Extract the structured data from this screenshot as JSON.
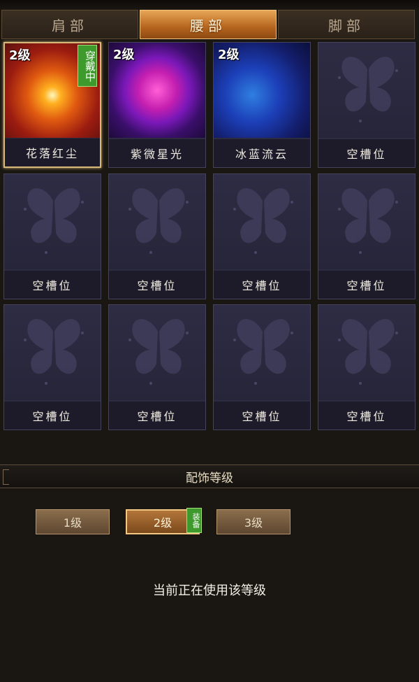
{
  "tabs": [
    {
      "label": "肩部",
      "active": false
    },
    {
      "label": "腰部",
      "active": true
    },
    {
      "label": "脚部",
      "active": false
    }
  ],
  "slots": [
    {
      "name": "花落红尘",
      "level": "2级",
      "badge": "穿戴中",
      "art": "flame"
    },
    {
      "name": "紫微星光",
      "level": "2级",
      "badge": "",
      "art": "purple"
    },
    {
      "name": "冰蓝流云",
      "level": "2级",
      "badge": "",
      "art": "blue"
    },
    {
      "name": "空槽位",
      "level": "",
      "badge": "",
      "art": "empty"
    },
    {
      "name": "空槽位",
      "level": "",
      "badge": "",
      "art": "empty"
    },
    {
      "name": "空槽位",
      "level": "",
      "badge": "",
      "art": "empty"
    },
    {
      "name": "空槽位",
      "level": "",
      "badge": "",
      "art": "empty"
    },
    {
      "name": "空槽位",
      "level": "",
      "badge": "",
      "art": "empty"
    },
    {
      "name": "空槽位",
      "level": "",
      "badge": "",
      "art": "empty"
    },
    {
      "name": "空槽位",
      "level": "",
      "badge": "",
      "art": "empty"
    },
    {
      "name": "空槽位",
      "level": "",
      "badge": "",
      "art": "empty"
    },
    {
      "name": "空槽位",
      "level": "",
      "badge": "",
      "art": "empty"
    }
  ],
  "section": {
    "title": "配饰等级"
  },
  "levels": [
    {
      "label": "1级",
      "active": false
    },
    {
      "label": "2级",
      "active": true
    },
    {
      "label": "3级",
      "active": false
    }
  ],
  "equip_badge": "装备",
  "status_text": "当前正在使用该等级"
}
